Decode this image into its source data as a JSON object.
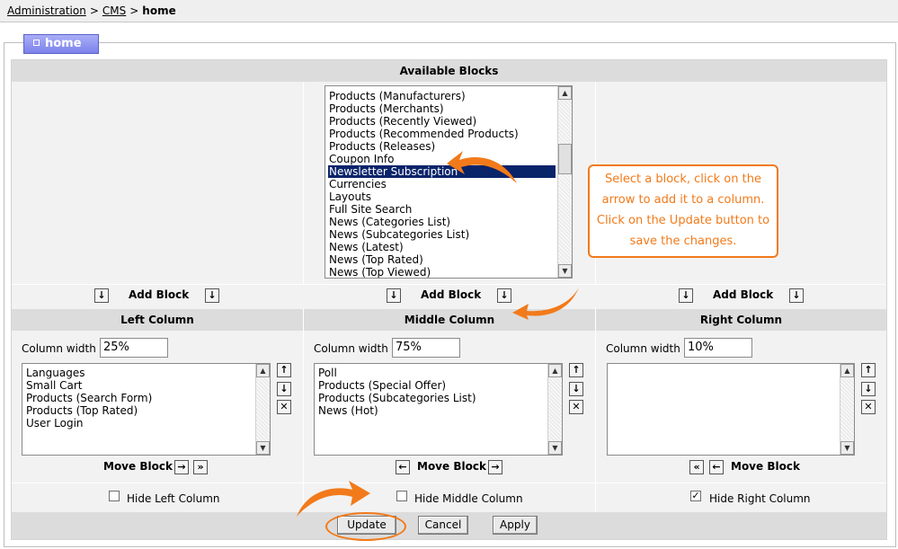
{
  "breadcrumb": {
    "items": [
      "Administration",
      "CMS"
    ],
    "current": "home",
    "separator": ">"
  },
  "tab": {
    "label": "home"
  },
  "available": {
    "header": "Available Blocks",
    "items": [
      "Products (Manufacturers)",
      "Products (Merchants)",
      "Products (Recently Viewed)",
      "Products (Recommended Products)",
      "Products (Releases)",
      "Coupon Info",
      "Newsletter Subscription",
      "Currencies",
      "Layouts",
      "Full Site Search",
      "News (Categories List)",
      "News (Subcategories List)",
      "News (Latest)",
      "News (Top Rated)",
      "News (Top Viewed)"
    ],
    "selected": "Newsletter Subscription"
  },
  "add_block_label": "Add Block",
  "columns": {
    "left": {
      "header": "Left Column",
      "width_label": "Column width",
      "width_value": "25%",
      "items": [
        "Languages",
        "Small Cart",
        "Products (Search Form)",
        "Products (Top Rated)",
        "User Login"
      ],
      "move_label": "Move Block",
      "hide_label": "Hide Left Column",
      "hide_checked": false
    },
    "middle": {
      "header": "Middle Column",
      "width_label": "Column width",
      "width_value": "75%",
      "items": [
        "Poll",
        "Products (Special Offer)",
        "Products (Subcategories List)",
        "News (Hot)"
      ],
      "move_label": "Move Block",
      "hide_label": "Hide Middle Column",
      "hide_checked": false
    },
    "right": {
      "header": "Right Column",
      "width_label": "Column width",
      "width_value": "10%",
      "items": [],
      "move_label": "Move Block",
      "hide_label": "Hide Right Column",
      "hide_checked": true
    }
  },
  "buttons": {
    "update": "Update",
    "cancel": "Cancel",
    "apply": "Apply"
  },
  "callout": {
    "line1": "Select a block, click on the",
    "line2": "arrow to add it to a column.",
    "line3": "Click on the Update button to",
    "line4": "save the changes."
  },
  "icons": {
    "down": "arrow-down-icon",
    "up": "arrow-up-icon",
    "left": "arrow-left-icon",
    "right": "arrow-right-icon",
    "delete": "close-icon",
    "to_first": "double-left-icon",
    "to_last": "double-right-icon"
  },
  "colors": {
    "accent": "#f27a1a",
    "selection": "#0a246a",
    "tab": "#7c82ea",
    "header_bg": "#dcdcdc"
  }
}
